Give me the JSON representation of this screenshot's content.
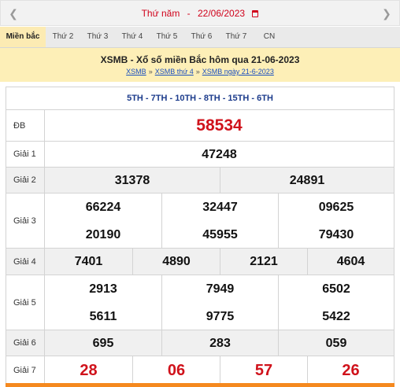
{
  "datebar": {
    "prev_icon": "chevron-left-icon",
    "next_icon": "chevron-right-icon",
    "weekday": "Thứ năm",
    "separator": "-",
    "date": "22/06/2023",
    "calendar_icon": "calendar-icon",
    "accent_color": "#d0021b"
  },
  "tabs": [
    {
      "label": "Miền bắc",
      "active": true
    },
    {
      "label": "Thứ 2"
    },
    {
      "label": "Thứ 3"
    },
    {
      "label": "Thứ 4"
    },
    {
      "label": "Thứ 5"
    },
    {
      "label": "Thứ 6"
    },
    {
      "label": "Thứ 7"
    },
    {
      "label": "CN"
    }
  ],
  "header": {
    "title": "XSMB - Xổ số miền Bắc hôm qua 21-06-2023",
    "breadcrumb": [
      "XSMB",
      "XSMB thứ 4",
      "XSMB ngày 21-6-2023"
    ],
    "breadcrumb_sep": "»"
  },
  "filters": "5TH - 7TH - 10TH - 8TH - 15TH - 6TH",
  "prizes": {
    "db": {
      "label": "ĐB",
      "numbers": [
        "58534"
      ]
    },
    "g1": {
      "label": "Giải 1",
      "numbers": [
        "47248"
      ]
    },
    "g2": {
      "label": "Giải 2",
      "numbers": [
        "31378",
        "24891"
      ]
    },
    "g3": {
      "label": "Giải 3",
      "numbers": [
        "66224",
        "32447",
        "09625",
        "20190",
        "45955",
        "79430"
      ]
    },
    "g4": {
      "label": "Giải 4",
      "numbers": [
        "7401",
        "4890",
        "2121",
        "4604"
      ]
    },
    "g5": {
      "label": "Giải 5",
      "numbers": [
        "2913",
        "7949",
        "6502",
        "5611",
        "9775",
        "5422"
      ]
    },
    "g6": {
      "label": "Giải 6",
      "numbers": [
        "695",
        "283",
        "059"
      ]
    },
    "g7": {
      "label": "Giải 7",
      "numbers": [
        "28",
        "06",
        "57",
        "26"
      ]
    }
  },
  "colors": {
    "special": "#d0121b",
    "header_bg": "#fdefb7",
    "tab_active_bg": "#fcebb3",
    "link": "#1a4fbf",
    "filter": "#1d3c8c",
    "bottom_bar": "#f5891f"
  }
}
